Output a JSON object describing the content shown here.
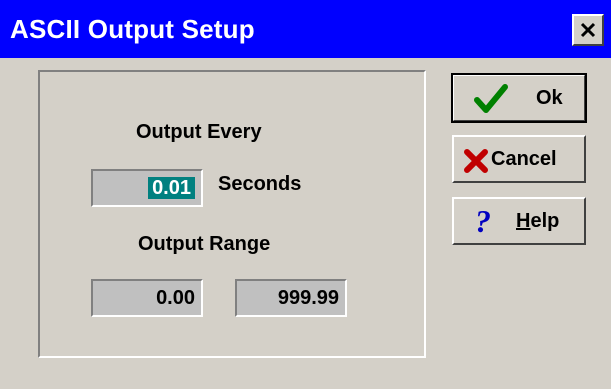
{
  "window": {
    "title": "ASCII Output Setup"
  },
  "output_every": {
    "label": "Output Every",
    "value": "0.01",
    "unit": "Seconds"
  },
  "output_range": {
    "label": "Output Range",
    "min": "0.00",
    "max": "999.99"
  },
  "buttons": {
    "ok": {
      "label": "Ok",
      "icon": "check-icon"
    },
    "cancel": {
      "label": "Cancel",
      "icon": "x-icon"
    },
    "help": {
      "label_mnemonic": "H",
      "label_rest": "elp",
      "icon": "question-icon"
    }
  },
  "colors": {
    "titlebar": "#0000ff",
    "selection": "#008080",
    "check": "#008000",
    "cancel_x": "#c00000",
    "help_q": "#0000c0"
  }
}
